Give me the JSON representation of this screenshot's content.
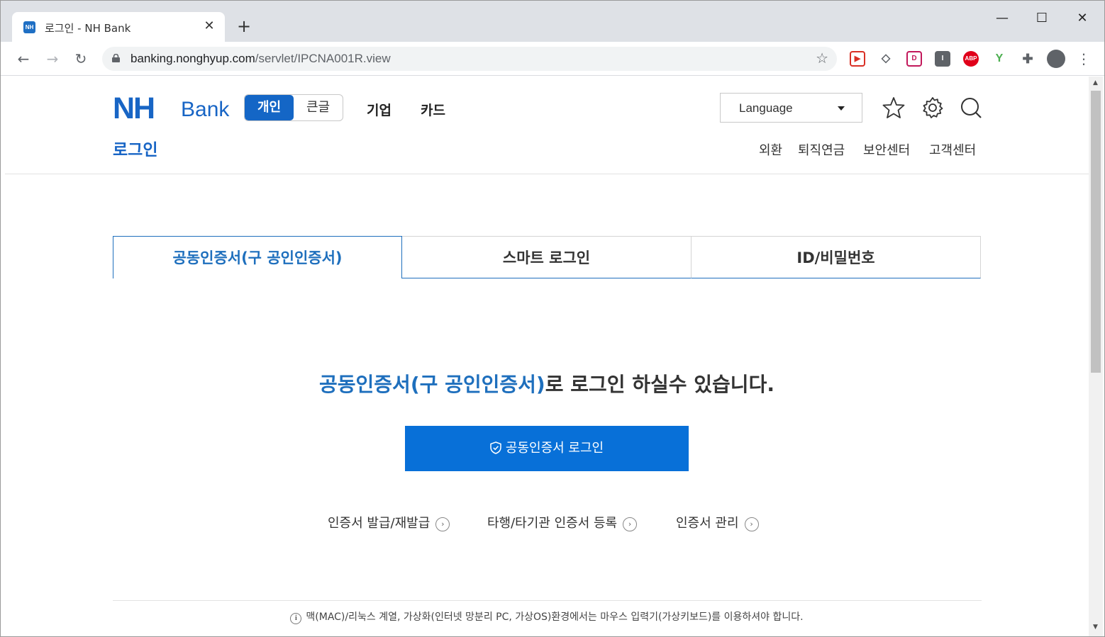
{
  "browser": {
    "tab_title": "로그인 - NH Bank",
    "favicon_text": "NH",
    "url_host": "banking.nonghyup.com",
    "url_path": "/servlet/IPCNA001R.view",
    "extensions": [
      {
        "name": "media-extension-icon",
        "color": "#d93025",
        "text": "▶"
      },
      {
        "name": "tag-extension-icon",
        "color": "#ffffff",
        "text": "◇"
      },
      {
        "name": "screen-extension-icon",
        "color": "#c2185b",
        "text": "D"
      },
      {
        "name": "info-extension-icon",
        "color": "#5f6368",
        "text": "I"
      },
      {
        "name": "adblock-extension-icon",
        "color": "#e0001a",
        "text": "ABP"
      },
      {
        "name": "plant-extension-icon",
        "color": "#ffffff",
        "text": "Y"
      }
    ]
  },
  "header": {
    "logo_nh": "NH",
    "logo_bank": "Bank",
    "toggle_personal": "개인",
    "toggle_large": "큰글",
    "nav_business": "기업",
    "nav_card": "카드",
    "language_label": "Language",
    "breadcrumb": "로그인",
    "utility_links": [
      "외환",
      "퇴직연금",
      "보안센터",
      "고객센터"
    ]
  },
  "login_tabs": [
    "공동인증서(구 공인인증서)",
    "스마트 로그인",
    "ID/비밀번호"
  ],
  "main": {
    "headline_highlight": "공동인증서(구 공인인증서)",
    "headline_rest": "로 로그인 하실수 있습니다.",
    "login_button": "공동인증서 로그인",
    "links": [
      "인증서 발급/재발급",
      "타행/타기관 인증서 등록",
      "인증서 관리"
    ],
    "notice": "맥(MAC)/리눅스 계열, 가상화(인터넷 망분리 PC, 가상OS)환경에서는 마우스 입력기(가상키보드)를 이용하셔야 합니다."
  },
  "colors": {
    "brand_blue": "#1865c5",
    "button_blue": "#0870d8",
    "accent_blue": "#1e6fbd"
  }
}
